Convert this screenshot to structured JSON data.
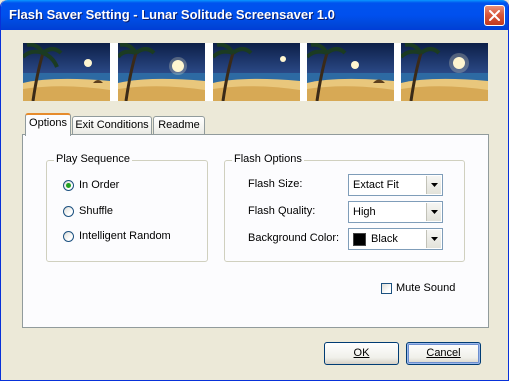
{
  "window": {
    "title": "Flash Saver Setting - Lunar Solitude Screensaver 1.0"
  },
  "banner": {
    "thumbnails": [
      "beach-scene-1",
      "beach-scene-2",
      "beach-scene-3",
      "beach-scene-4",
      "beach-scene-5"
    ]
  },
  "tabs": [
    {
      "label": "Options",
      "active": true
    },
    {
      "label": "Exit Conditions",
      "active": false
    },
    {
      "label": "Readme",
      "active": false
    }
  ],
  "play_sequence": {
    "label": "Play Sequence",
    "options": [
      {
        "label": "In Order",
        "selected": true
      },
      {
        "label": "Shuffle",
        "selected": false
      },
      {
        "label": "Intelligent Random",
        "selected": false
      }
    ]
  },
  "flash_options": {
    "label": "Flash Options",
    "size": {
      "label": "Flash Size:",
      "value": "Extact Fit"
    },
    "quality": {
      "label": "Flash Quality:",
      "value": "High"
    },
    "background": {
      "label": "Background Color:",
      "value": "Black",
      "swatch_color": "#000000"
    }
  },
  "mute": {
    "label": "Mute Sound",
    "checked": false
  },
  "buttons": {
    "ok": {
      "label": "OK"
    },
    "cancel": {
      "label": "Cancel"
    }
  },
  "colors": {
    "titlebar": "#0053ee",
    "close_button": "#d9583b",
    "radio_selected": "#21a121",
    "tab_highlight": "#e68b2c"
  }
}
